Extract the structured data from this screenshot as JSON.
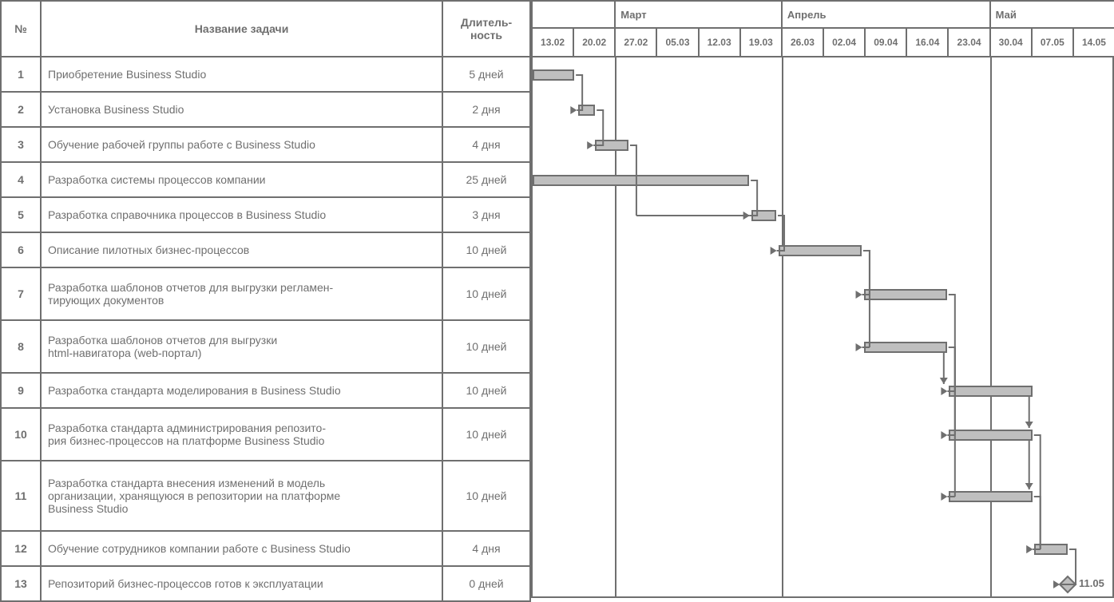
{
  "columns": {
    "num": "№",
    "name": "Название задачи",
    "dur": "Длитель-\nность"
  },
  "months": [
    {
      "label": "",
      "span": 2
    },
    {
      "label": "Март",
      "span": 4
    },
    {
      "label": "Апрель",
      "span": 5
    },
    {
      "label": "Май",
      "span": 3
    }
  ],
  "days": [
    "13.02",
    "20.02",
    "27.02",
    "05.03",
    "12.03",
    "19.03",
    "26.03",
    "02.04",
    "09.04",
    "16.04",
    "23.04",
    "30.04",
    "07.05",
    "14.05"
  ],
  "tasks": [
    {
      "n": "1",
      "name": "Приобретение Business Studio",
      "dur": "5 дней"
    },
    {
      "n": "2",
      "name": "Установка Business Studio",
      "dur": "2 дня"
    },
    {
      "n": "3",
      "name": "Обучение рабочей группы работе с Business Studio",
      "dur": "4 дня"
    },
    {
      "n": "4",
      "name": "Разработка системы процессов компании",
      "dur": "25 дней"
    },
    {
      "n": "5",
      "name": "Разработка справочника процессов в Business Studio",
      "dur": "3 дня"
    },
    {
      "n": "6",
      "name": "Описание пилотных бизнес-процессов",
      "dur": "10 дней"
    },
    {
      "n": "7",
      "name": "Разработка шаблонов отчетов для выгрузки регламен-\nтирующих документов",
      "dur": "10 дней"
    },
    {
      "n": "8",
      "name": "Разработка шаблонов отчетов для выгрузки\nhtml-навигатора (web-портал)",
      "dur": "10 дней"
    },
    {
      "n": "9",
      "name": "Разработка стандарта моделирования в Business Studio",
      "dur": "10 дней"
    },
    {
      "n": "10",
      "name": "Разработка стандарта администрирования репозито-\nрия бизнес-процессов на платформе Business Studio",
      "dur": "10 дней"
    },
    {
      "n": "11",
      "name": "Разработка стандарта внесения изменений в модель\nорганизации, хранящуюся в репозитории на платформе\nBusiness Studio",
      "dur": "10 дней"
    },
    {
      "n": "12",
      "name": "Обучение сотрудников компании работе с Business Studio",
      "dur": "4 дня"
    },
    {
      "n": "13",
      "name": "Репозиторий бизнес-процессов готов к эксплуатации",
      "dur": "0 дней"
    }
  ],
  "milestone_label": "11.05",
  "chart_data": {
    "type": "gantt",
    "timeline_start": "13.02",
    "week_dates": [
      "13.02",
      "20.02",
      "27.02",
      "05.03",
      "12.03",
      "19.03",
      "26.03",
      "02.04",
      "09.04",
      "16.04",
      "23.04",
      "30.04",
      "07.05",
      "14.05"
    ],
    "month_sections": [
      {
        "name": "",
        "weeks": [
          "13.02",
          "20.02"
        ]
      },
      {
        "name": "Март",
        "weeks": [
          "27.02",
          "05.03",
          "12.03",
          "19.03"
        ]
      },
      {
        "name": "Апрель",
        "weeks": [
          "26.03",
          "02.04",
          "09.04",
          "16.04",
          "23.04"
        ]
      },
      {
        "name": "Май",
        "weeks": [
          "30.04",
          "07.05",
          "14.05"
        ]
      }
    ],
    "tasks": [
      {
        "id": 1,
        "name": "Приобретение Business Studio",
        "duration_days": 5,
        "start": "13.02",
        "end": "17.02",
        "depends_on": []
      },
      {
        "id": 2,
        "name": "Установка Business Studio",
        "duration_days": 2,
        "start": "20.02",
        "end": "21.02",
        "depends_on": [
          1
        ]
      },
      {
        "id": 3,
        "name": "Обучение рабочей группы работе с Business Studio",
        "duration_days": 4,
        "start": "22.02",
        "end": "27.02",
        "depends_on": [
          2
        ]
      },
      {
        "id": 4,
        "name": "Разработка системы процессов компании",
        "duration_days": 25,
        "start": "13.02",
        "end": "19.03",
        "depends_on": []
      },
      {
        "id": 5,
        "name": "Разработка справочника процессов в Business Studio",
        "duration_days": 3,
        "start": "20.03",
        "end": "22.03",
        "depends_on": [
          3,
          4
        ]
      },
      {
        "id": 6,
        "name": "Описание пилотных бизнес-процессов",
        "duration_days": 10,
        "start": "23.03",
        "end": "05.04",
        "depends_on": [
          5
        ]
      },
      {
        "id": 7,
        "name": "Разработка шаблонов отчетов для выгрузки регламентирующих документов",
        "duration_days": 10,
        "start": "06.04",
        "end": "19.04",
        "depends_on": [
          6
        ]
      },
      {
        "id": 8,
        "name": "Разработка шаблонов отчетов для выгрузки html-навигатора (web-портал)",
        "duration_days": 10,
        "start": "06.04",
        "end": "19.04",
        "depends_on": [
          6
        ]
      },
      {
        "id": 9,
        "name": "Разработка стандарта моделирования в Business Studio",
        "duration_days": 10,
        "start": "20.04",
        "end": "03.05",
        "depends_on": [
          7,
          8
        ]
      },
      {
        "id": 10,
        "name": "Разработка стандарта администрирования репозитория бизнес-процессов на платформе Business Studio",
        "duration_days": 10,
        "start": "20.04",
        "end": "03.05",
        "depends_on": [
          7,
          8
        ]
      },
      {
        "id": 11,
        "name": "Разработка стандарта внесения изменений в модель организации, хранящуюся в репозитории на платформе Business Studio",
        "duration_days": 10,
        "start": "20.04",
        "end": "03.05",
        "depends_on": [
          7,
          8
        ]
      },
      {
        "id": 12,
        "name": "Обучение сотрудников компании работе с Business Studio",
        "duration_days": 4,
        "start": "04.05",
        "end": "09.05",
        "depends_on": [
          9,
          10,
          11
        ]
      },
      {
        "id": 13,
        "name": "Репозиторий бизнес-процессов готов к эксплуатации",
        "duration_days": 0,
        "milestone": true,
        "date": "11.05",
        "depends_on": [
          12
        ]
      }
    ]
  }
}
